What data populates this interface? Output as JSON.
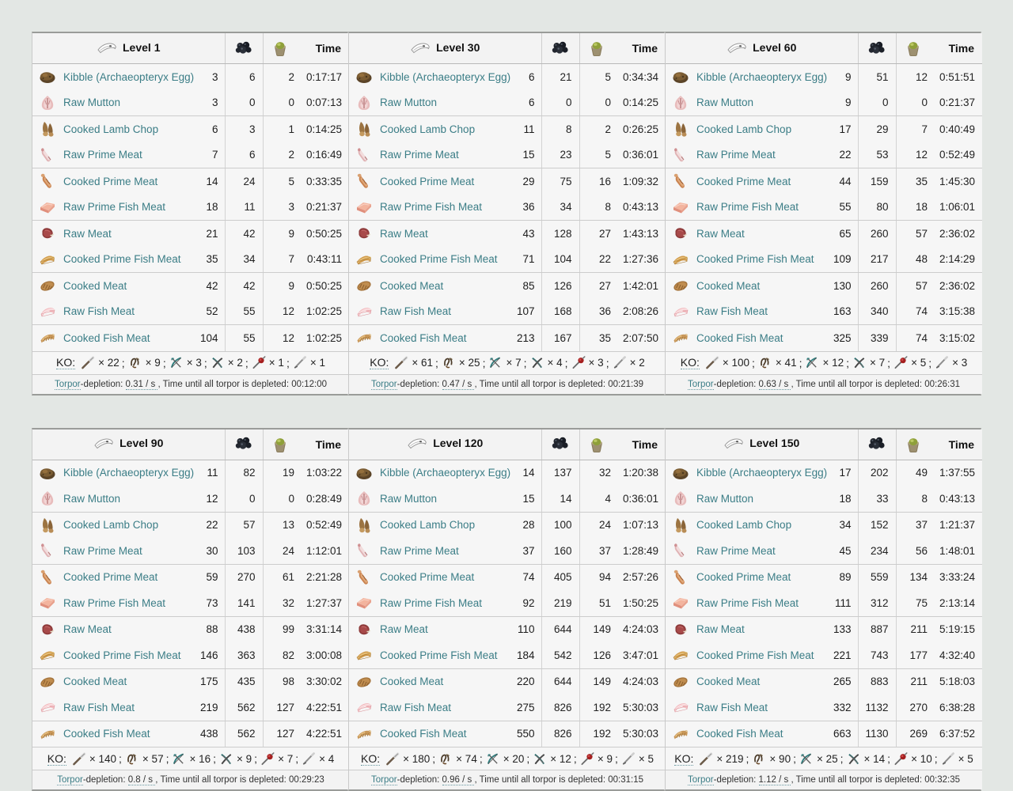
{
  "columns": {
    "level_prefix": "Level",
    "narcoberry_icon": "narcoberry-icon",
    "narcotic_icon": "narcotic-icon",
    "dino_icon": "dino-head-icon",
    "time_label": "Time"
  },
  "labels": {
    "ko_label": "KO:",
    "torpor_word": "Torpor",
    "torpor_mid": "-depletion: ",
    "torpor_rate_unit": " / s, ",
    "torpor_tail": "Time until all torpor is depleted: ",
    "separator": "; ",
    "times": "× "
  },
  "colors": {
    "link": "#3b7d86",
    "page_bg": "#e3e7e4",
    "panel_bg": "#f3f3f3",
    "row_bg": "#f6f6f6",
    "border": "#cccccc"
  },
  "weapons": [
    {
      "name": "wooden-club-icon",
      "key": "club"
    },
    {
      "name": "slingshot-icon",
      "key": "slingshot"
    },
    {
      "name": "bow-icon",
      "key": "bow"
    },
    {
      "name": "crossbow-icon",
      "key": "crossbow"
    },
    {
      "name": "tranq-dart-icon",
      "key": "dart"
    },
    {
      "name": "tranquilizer-arrow-icon",
      "key": "tranqarrow"
    }
  ],
  "foods_order": [
    {
      "name": "Kibble (Archaeopteryx Egg)",
      "icon": "kibble-icon"
    },
    {
      "name": "Raw Mutton",
      "icon": "raw-mutton-icon"
    },
    {
      "name": "Cooked Lamb Chop",
      "icon": "cooked-lamb-chop-icon"
    },
    {
      "name": "Raw Prime Meat",
      "icon": "raw-prime-meat-icon"
    },
    {
      "name": "Cooked Prime Meat",
      "icon": "cooked-prime-meat-icon"
    },
    {
      "name": "Raw Prime Fish Meat",
      "icon": "raw-prime-fish-meat-icon"
    },
    {
      "name": "Raw Meat",
      "icon": "raw-meat-icon"
    },
    {
      "name": "Cooked Prime Fish Meat",
      "icon": "cooked-prime-fish-meat-icon"
    },
    {
      "name": "Cooked Meat",
      "icon": "cooked-meat-icon"
    },
    {
      "name": "Raw Fish Meat",
      "icon": "raw-fish-meat-icon"
    },
    {
      "name": "Cooked Fish Meat",
      "icon": "cooked-fish-meat-icon"
    }
  ],
  "tables": [
    {
      "level": "Level 1",
      "rows": [
        {
          "food": "Kibble (Archaeopteryx Egg)",
          "icon": "kibble-icon",
          "qty": "3",
          "narcoberries": "6",
          "narcotics": "2",
          "time": "0:17:17"
        },
        {
          "food": "Raw Mutton",
          "icon": "raw-mutton-icon",
          "qty": "3",
          "narcoberries": "0",
          "narcotics": "0",
          "time": "0:07:13"
        },
        {
          "food": "Cooked Lamb Chop",
          "icon": "cooked-lamb-chop-icon",
          "qty": "6",
          "narcoberries": "3",
          "narcotics": "1",
          "time": "0:14:25"
        },
        {
          "food": "Raw Prime Meat",
          "icon": "raw-prime-meat-icon",
          "qty": "7",
          "narcoberries": "6",
          "narcotics": "2",
          "time": "0:16:49"
        },
        {
          "food": "Cooked Prime Meat",
          "icon": "cooked-prime-meat-icon",
          "qty": "14",
          "narcoberries": "24",
          "narcotics": "5",
          "time": "0:33:35"
        },
        {
          "food": "Raw Prime Fish Meat",
          "icon": "raw-prime-fish-meat-icon",
          "qty": "18",
          "narcoberries": "11",
          "narcotics": "3",
          "time": "0:21:37"
        },
        {
          "food": "Raw Meat",
          "icon": "raw-meat-icon",
          "qty": "21",
          "narcoberries": "42",
          "narcotics": "9",
          "time": "0:50:25"
        },
        {
          "food": "Cooked Prime Fish Meat",
          "icon": "cooked-prime-fish-meat-icon",
          "qty": "35",
          "narcoberries": "34",
          "narcotics": "7",
          "time": "0:43:11"
        },
        {
          "food": "Cooked Meat",
          "icon": "cooked-meat-icon",
          "qty": "42",
          "narcoberries": "42",
          "narcotics": "9",
          "time": "0:50:25"
        },
        {
          "food": "Raw Fish Meat",
          "icon": "raw-fish-meat-icon",
          "qty": "52",
          "narcoberries": "55",
          "narcotics": "12",
          "time": "1:02:25"
        },
        {
          "food": "Cooked Fish Meat",
          "icon": "cooked-fish-meat-icon",
          "qty": "104",
          "narcoberries": "55",
          "narcotics": "12",
          "time": "1:02:25"
        }
      ],
      "ko": [
        {
          "weapon": "wooden-club-icon",
          "count": "22"
        },
        {
          "weapon": "slingshot-icon",
          "count": "9"
        },
        {
          "weapon": "bow-icon",
          "count": "3"
        },
        {
          "weapon": "crossbow-icon",
          "count": "2"
        },
        {
          "weapon": "tranq-dart-icon",
          "count": "1"
        },
        {
          "weapon": "tranquilizer-arrow-icon",
          "count": "1"
        }
      ],
      "torpor_rate": "0.31",
      "torpor_time": "00:12:00"
    },
    {
      "level": "Level 30",
      "rows": [
        {
          "food": "Kibble (Archaeopteryx Egg)",
          "icon": "kibble-icon",
          "qty": "6",
          "narcoberries": "21",
          "narcotics": "5",
          "time": "0:34:34"
        },
        {
          "food": "Raw Mutton",
          "icon": "raw-mutton-icon",
          "qty": "6",
          "narcoberries": "0",
          "narcotics": "0",
          "time": "0:14:25"
        },
        {
          "food": "Cooked Lamb Chop",
          "icon": "cooked-lamb-chop-icon",
          "qty": "11",
          "narcoberries": "8",
          "narcotics": "2",
          "time": "0:26:25"
        },
        {
          "food": "Raw Prime Meat",
          "icon": "raw-prime-meat-icon",
          "qty": "15",
          "narcoberries": "23",
          "narcotics": "5",
          "time": "0:36:01"
        },
        {
          "food": "Cooked Prime Meat",
          "icon": "cooked-prime-meat-icon",
          "qty": "29",
          "narcoberries": "75",
          "narcotics": "16",
          "time": "1:09:32"
        },
        {
          "food": "Raw Prime Fish Meat",
          "icon": "raw-prime-fish-meat-icon",
          "qty": "36",
          "narcoberries": "34",
          "narcotics": "8",
          "time": "0:43:13"
        },
        {
          "food": "Raw Meat",
          "icon": "raw-meat-icon",
          "qty": "43",
          "narcoberries": "128",
          "narcotics": "27",
          "time": "1:43:13"
        },
        {
          "food": "Cooked Prime Fish Meat",
          "icon": "cooked-prime-fish-meat-icon",
          "qty": "71",
          "narcoberries": "104",
          "narcotics": "22",
          "time": "1:27:36"
        },
        {
          "food": "Cooked Meat",
          "icon": "cooked-meat-icon",
          "qty": "85",
          "narcoberries": "126",
          "narcotics": "27",
          "time": "1:42:01"
        },
        {
          "food": "Raw Fish Meat",
          "icon": "raw-fish-meat-icon",
          "qty": "107",
          "narcoberries": "168",
          "narcotics": "36",
          "time": "2:08:26"
        },
        {
          "food": "Cooked Fish Meat",
          "icon": "cooked-fish-meat-icon",
          "qty": "213",
          "narcoberries": "167",
          "narcotics": "35",
          "time": "2:07:50"
        }
      ],
      "ko": [
        {
          "weapon": "wooden-club-icon",
          "count": "61"
        },
        {
          "weapon": "slingshot-icon",
          "count": "25"
        },
        {
          "weapon": "bow-icon",
          "count": "7"
        },
        {
          "weapon": "crossbow-icon",
          "count": "4"
        },
        {
          "weapon": "tranq-dart-icon",
          "count": "3"
        },
        {
          "weapon": "tranquilizer-arrow-icon",
          "count": "2"
        }
      ],
      "torpor_rate": "0.47",
      "torpor_time": "00:21:39"
    },
    {
      "level": "Level 60",
      "rows": [
        {
          "food": "Kibble (Archaeopteryx Egg)",
          "icon": "kibble-icon",
          "qty": "9",
          "narcoberries": "51",
          "narcotics": "12",
          "time": "0:51:51"
        },
        {
          "food": "Raw Mutton",
          "icon": "raw-mutton-icon",
          "qty": "9",
          "narcoberries": "0",
          "narcotics": "0",
          "time": "0:21:37"
        },
        {
          "food": "Cooked Lamb Chop",
          "icon": "cooked-lamb-chop-icon",
          "qty": "17",
          "narcoberries": "29",
          "narcotics": "7",
          "time": "0:40:49"
        },
        {
          "food": "Raw Prime Meat",
          "icon": "raw-prime-meat-icon",
          "qty": "22",
          "narcoberries": "53",
          "narcotics": "12",
          "time": "0:52:49"
        },
        {
          "food": "Cooked Prime Meat",
          "icon": "cooked-prime-meat-icon",
          "qty": "44",
          "narcoberries": "159",
          "narcotics": "35",
          "time": "1:45:30"
        },
        {
          "food": "Raw Prime Fish Meat",
          "icon": "raw-prime-fish-meat-icon",
          "qty": "55",
          "narcoberries": "80",
          "narcotics": "18",
          "time": "1:06:01"
        },
        {
          "food": "Raw Meat",
          "icon": "raw-meat-icon",
          "qty": "65",
          "narcoberries": "260",
          "narcotics": "57",
          "time": "2:36:02"
        },
        {
          "food": "Cooked Prime Fish Meat",
          "icon": "cooked-prime-fish-meat-icon",
          "qty": "109",
          "narcoberries": "217",
          "narcotics": "48",
          "time": "2:14:29"
        },
        {
          "food": "Cooked Meat",
          "icon": "cooked-meat-icon",
          "qty": "130",
          "narcoberries": "260",
          "narcotics": "57",
          "time": "2:36:02"
        },
        {
          "food": "Raw Fish Meat",
          "icon": "raw-fish-meat-icon",
          "qty": "163",
          "narcoberries": "340",
          "narcotics": "74",
          "time": "3:15:38"
        },
        {
          "food": "Cooked Fish Meat",
          "icon": "cooked-fish-meat-icon",
          "qty": "325",
          "narcoberries": "339",
          "narcotics": "74",
          "time": "3:15:02"
        }
      ],
      "ko": [
        {
          "weapon": "wooden-club-icon",
          "count": "100"
        },
        {
          "weapon": "slingshot-icon",
          "count": "41"
        },
        {
          "weapon": "bow-icon",
          "count": "12"
        },
        {
          "weapon": "crossbow-icon",
          "count": "7"
        },
        {
          "weapon": "tranq-dart-icon",
          "count": "5"
        },
        {
          "weapon": "tranquilizer-arrow-icon",
          "count": "3"
        }
      ],
      "torpor_rate": "0.63",
      "torpor_time": "00:26:31"
    },
    {
      "level": "Level 90",
      "rows": [
        {
          "food": "Kibble (Archaeopteryx Egg)",
          "icon": "kibble-icon",
          "qty": "11",
          "narcoberries": "82",
          "narcotics": "19",
          "time": "1:03:22"
        },
        {
          "food": "Raw Mutton",
          "icon": "raw-mutton-icon",
          "qty": "12",
          "narcoberries": "0",
          "narcotics": "0",
          "time": "0:28:49"
        },
        {
          "food": "Cooked Lamb Chop",
          "icon": "cooked-lamb-chop-icon",
          "qty": "22",
          "narcoberries": "57",
          "narcotics": "13",
          "time": "0:52:49"
        },
        {
          "food": "Raw Prime Meat",
          "icon": "raw-prime-meat-icon",
          "qty": "30",
          "narcoberries": "103",
          "narcotics": "24",
          "time": "1:12:01"
        },
        {
          "food": "Cooked Prime Meat",
          "icon": "cooked-prime-meat-icon",
          "qty": "59",
          "narcoberries": "270",
          "narcotics": "61",
          "time": "2:21:28"
        },
        {
          "food": "Raw Prime Fish Meat",
          "icon": "raw-prime-fish-meat-icon",
          "qty": "73",
          "narcoberries": "141",
          "narcotics": "32",
          "time": "1:27:37"
        },
        {
          "food": "Raw Meat",
          "icon": "raw-meat-icon",
          "qty": "88",
          "narcoberries": "438",
          "narcotics": "99",
          "time": "3:31:14"
        },
        {
          "food": "Cooked Prime Fish Meat",
          "icon": "cooked-prime-fish-meat-icon",
          "qty": "146",
          "narcoberries": "363",
          "narcotics": "82",
          "time": "3:00:08"
        },
        {
          "food": "Cooked Meat",
          "icon": "cooked-meat-icon",
          "qty": "175",
          "narcoberries": "435",
          "narcotics": "98",
          "time": "3:30:02"
        },
        {
          "food": "Raw Fish Meat",
          "icon": "raw-fish-meat-icon",
          "qty": "219",
          "narcoberries": "562",
          "narcotics": "127",
          "time": "4:22:51"
        },
        {
          "food": "Cooked Fish Meat",
          "icon": "cooked-fish-meat-icon",
          "qty": "438",
          "narcoberries": "562",
          "narcotics": "127",
          "time": "4:22:51"
        }
      ],
      "ko": [
        {
          "weapon": "wooden-club-icon",
          "count": "140"
        },
        {
          "weapon": "slingshot-icon",
          "count": "57"
        },
        {
          "weapon": "bow-icon",
          "count": "16"
        },
        {
          "weapon": "crossbow-icon",
          "count": "9"
        },
        {
          "weapon": "tranq-dart-icon",
          "count": "7"
        },
        {
          "weapon": "tranquilizer-arrow-icon",
          "count": "4"
        }
      ],
      "torpor_rate": "0.8",
      "torpor_time": "00:29:23"
    },
    {
      "level": "Level 120",
      "rows": [
        {
          "food": "Kibble (Archaeopteryx Egg)",
          "icon": "kibble-icon",
          "qty": "14",
          "narcoberries": "137",
          "narcotics": "32",
          "time": "1:20:38"
        },
        {
          "food": "Raw Mutton",
          "icon": "raw-mutton-icon",
          "qty": "15",
          "narcoberries": "14",
          "narcotics": "4",
          "time": "0:36:01"
        },
        {
          "food": "Cooked Lamb Chop",
          "icon": "cooked-lamb-chop-icon",
          "qty": "28",
          "narcoberries": "100",
          "narcotics": "24",
          "time": "1:07:13"
        },
        {
          "food": "Raw Prime Meat",
          "icon": "raw-prime-meat-icon",
          "qty": "37",
          "narcoberries": "160",
          "narcotics": "37",
          "time": "1:28:49"
        },
        {
          "food": "Cooked Prime Meat",
          "icon": "cooked-prime-meat-icon",
          "qty": "74",
          "narcoberries": "405",
          "narcotics": "94",
          "time": "2:57:26"
        },
        {
          "food": "Raw Prime Fish Meat",
          "icon": "raw-prime-fish-meat-icon",
          "qty": "92",
          "narcoberries": "219",
          "narcotics": "51",
          "time": "1:50:25"
        },
        {
          "food": "Raw Meat",
          "icon": "raw-meat-icon",
          "qty": "110",
          "narcoberries": "644",
          "narcotics": "149",
          "time": "4:24:03"
        },
        {
          "food": "Cooked Prime Fish Meat",
          "icon": "cooked-prime-fish-meat-icon",
          "qty": "184",
          "narcoberries": "542",
          "narcotics": "126",
          "time": "3:47:01"
        },
        {
          "food": "Cooked Meat",
          "icon": "cooked-meat-icon",
          "qty": "220",
          "narcoberries": "644",
          "narcotics": "149",
          "time": "4:24:03"
        },
        {
          "food": "Raw Fish Meat",
          "icon": "raw-fish-meat-icon",
          "qty": "275",
          "narcoberries": "826",
          "narcotics": "192",
          "time": "5:30:03"
        },
        {
          "food": "Cooked Fish Meat",
          "icon": "cooked-fish-meat-icon",
          "qty": "550",
          "narcoberries": "826",
          "narcotics": "192",
          "time": "5:30:03"
        }
      ],
      "ko": [
        {
          "weapon": "wooden-club-icon",
          "count": "180"
        },
        {
          "weapon": "slingshot-icon",
          "count": "74"
        },
        {
          "weapon": "bow-icon",
          "count": "20"
        },
        {
          "weapon": "crossbow-icon",
          "count": "12"
        },
        {
          "weapon": "tranq-dart-icon",
          "count": "9"
        },
        {
          "weapon": "tranquilizer-arrow-icon",
          "count": "5"
        }
      ],
      "torpor_rate": "0.96",
      "torpor_time": "00:31:15"
    },
    {
      "level": "Level 150",
      "rows": [
        {
          "food": "Kibble (Archaeopteryx Egg)",
          "icon": "kibble-icon",
          "qty": "17",
          "narcoberries": "202",
          "narcotics": "49",
          "time": "1:37:55"
        },
        {
          "food": "Raw Mutton",
          "icon": "raw-mutton-icon",
          "qty": "18",
          "narcoberries": "33",
          "narcotics": "8",
          "time": "0:43:13"
        },
        {
          "food": "Cooked Lamb Chop",
          "icon": "cooked-lamb-chop-icon",
          "qty": "34",
          "narcoberries": "152",
          "narcotics": "37",
          "time": "1:21:37"
        },
        {
          "food": "Raw Prime Meat",
          "icon": "raw-prime-meat-icon",
          "qty": "45",
          "narcoberries": "234",
          "narcotics": "56",
          "time": "1:48:01"
        },
        {
          "food": "Cooked Prime Meat",
          "icon": "cooked-prime-meat-icon",
          "qty": "89",
          "narcoberries": "559",
          "narcotics": "134",
          "time": "3:33:24"
        },
        {
          "food": "Raw Prime Fish Meat",
          "icon": "raw-prime-fish-meat-icon",
          "qty": "111",
          "narcoberries": "312",
          "narcotics": "75",
          "time": "2:13:14"
        },
        {
          "food": "Raw Meat",
          "icon": "raw-meat-icon",
          "qty": "133",
          "narcoberries": "887",
          "narcotics": "211",
          "time": "5:19:15"
        },
        {
          "food": "Cooked Prime Fish Meat",
          "icon": "cooked-prime-fish-meat-icon",
          "qty": "221",
          "narcoberries": "743",
          "narcotics": "177",
          "time": "4:32:40"
        },
        {
          "food": "Cooked Meat",
          "icon": "cooked-meat-icon",
          "qty": "265",
          "narcoberries": "883",
          "narcotics": "211",
          "time": "5:18:03"
        },
        {
          "food": "Raw Fish Meat",
          "icon": "raw-fish-meat-icon",
          "qty": "332",
          "narcoberries": "1132",
          "narcotics": "270",
          "time": "6:38:28"
        },
        {
          "food": "Cooked Fish Meat",
          "icon": "cooked-fish-meat-icon",
          "qty": "663",
          "narcoberries": "1130",
          "narcotics": "269",
          "time": "6:37:52"
        }
      ],
      "ko": [
        {
          "weapon": "wooden-club-icon",
          "count": "219"
        },
        {
          "weapon": "slingshot-icon",
          "count": "90"
        },
        {
          "weapon": "bow-icon",
          "count": "25"
        },
        {
          "weapon": "crossbow-icon",
          "count": "14"
        },
        {
          "weapon": "tranq-dart-icon",
          "count": "10"
        },
        {
          "weapon": "tranquilizer-arrow-icon",
          "count": "5"
        }
      ],
      "torpor_rate": "1.12",
      "torpor_time": "00:32:35"
    }
  ]
}
